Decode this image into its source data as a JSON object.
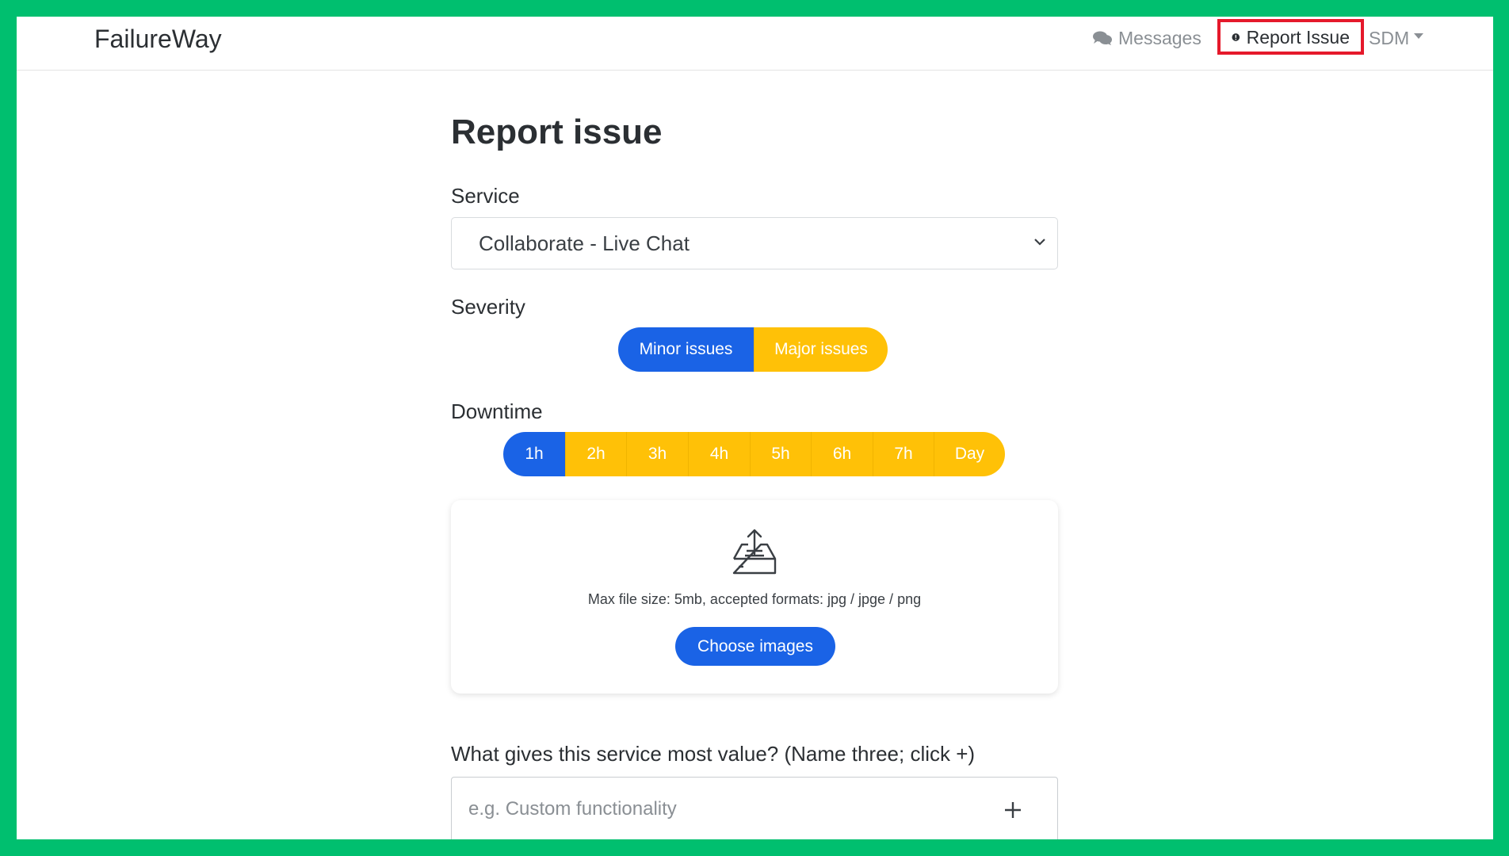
{
  "nav": {
    "brand": "FailureWay",
    "messages_label": "Messages",
    "report_label": "Report Issue",
    "user_label": "SDM",
    "highlight_color": "#e5192b"
  },
  "page": {
    "title": "Report issue"
  },
  "form": {
    "service_label": "Service",
    "service_value": "Collaborate - Live Chat",
    "severity_label": "Severity",
    "severity_options": [
      {
        "label": "Minor issues",
        "active": true
      },
      {
        "label": "Major issues",
        "active": false
      }
    ],
    "downtime_label": "Downtime",
    "downtime_options": [
      {
        "label": "1h",
        "active": true
      },
      {
        "label": "2h",
        "active": false
      },
      {
        "label": "3h",
        "active": false
      },
      {
        "label": "4h",
        "active": false
      },
      {
        "label": "5h",
        "active": false
      },
      {
        "label": "6h",
        "active": false
      },
      {
        "label": "7h",
        "active": false
      },
      {
        "label": "Day",
        "active": false
      }
    ],
    "upload_note": "Max file size: 5mb, accepted formats: jpg / jpge / png",
    "choose_images_label": "Choose images",
    "value_question": "What gives this service most value? (Name three; click +)",
    "value_placeholder": "e.g. Custom functionality"
  },
  "colors": {
    "primary": "#1a63e6",
    "warning": "#ffc107",
    "frame": "#00bf6f"
  }
}
